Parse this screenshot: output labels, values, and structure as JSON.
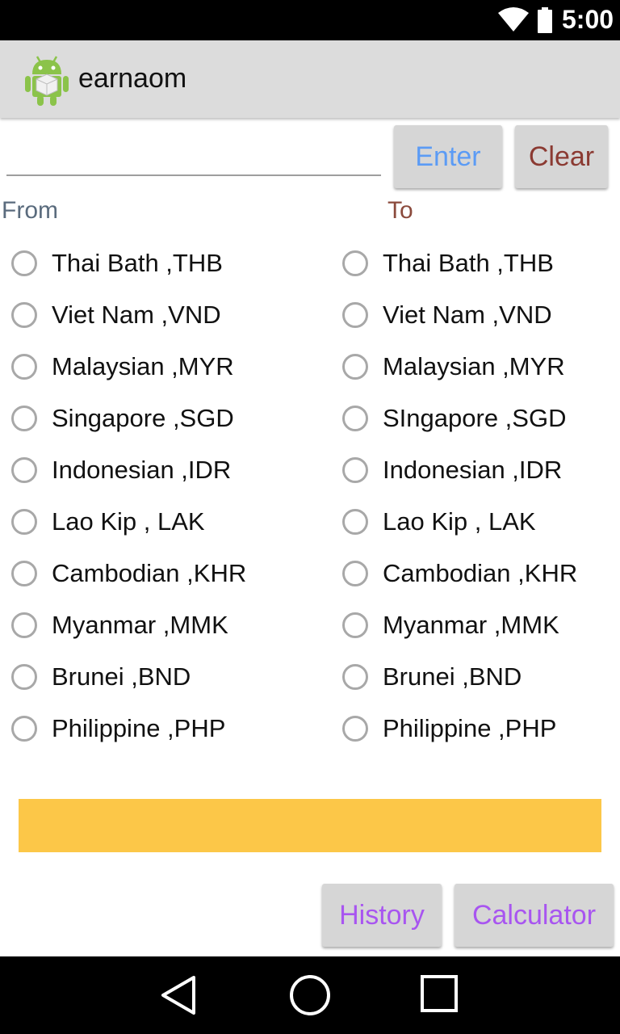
{
  "status_bar": {
    "time": "5:00",
    "icons": [
      "wifi-icon",
      "battery-icon"
    ]
  },
  "app_bar": {
    "icon": "android-app-icon",
    "title": "earnaom"
  },
  "input": {
    "value": "",
    "placeholder": ""
  },
  "buttons": {
    "enter": "Enter",
    "clear": "Clear",
    "history": "History",
    "calculator": "Calculator"
  },
  "labels": {
    "from": "From",
    "to": "To"
  },
  "from_options": [
    "Thai Bath ,THB",
    "Viet Nam ,VND",
    "Malaysian ,MYR",
    "Singapore ,SGD",
    "Indonesian ,IDR",
    "Lao Kip , LAK",
    "Cambodian ,KHR",
    "Myanmar ,MMK",
    "Brunei ,BND",
    "Philippine ,PHP"
  ],
  "to_options": [
    "Thai Bath ,THB",
    "Viet Nam ,VND",
    "Malaysian ,MYR",
    "SIngapore ,SGD",
    "Indonesian ,IDR",
    "Lao Kip , LAK",
    "Cambodian ,KHR",
    "Myanmar ,MMK",
    "Brunei ,BND",
    "Philippine ,PHP"
  ],
  "result": "",
  "colors": {
    "enter": "#5b9bf5",
    "clear": "#8b3a32",
    "from_label": "#5a6b7d",
    "to_label": "#8b4a3c",
    "result_bar": "#fcc748",
    "bottom_buttons": "#a855f0"
  },
  "nav_bar": {
    "icons": [
      "back-icon",
      "home-icon",
      "recents-icon"
    ]
  }
}
